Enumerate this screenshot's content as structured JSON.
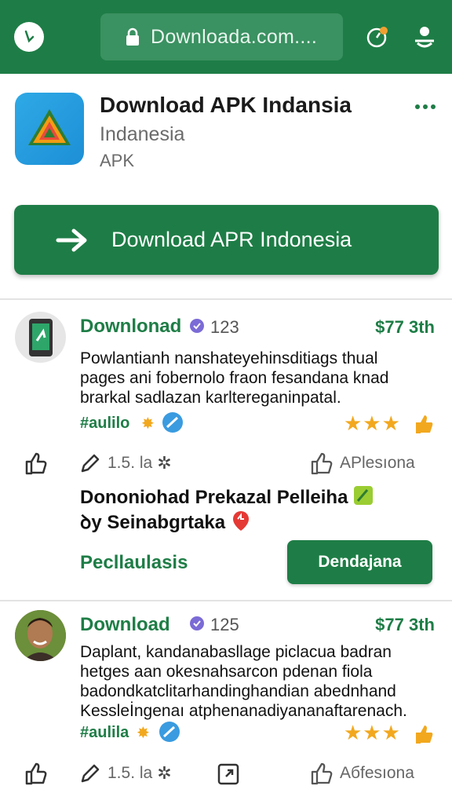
{
  "browser": {
    "url": "Downloada.com....",
    "icons": [
      "clock-icon",
      "lock-icon",
      "timer-badge-icon",
      "account-icon"
    ]
  },
  "app": {
    "title": "Download APK Indansia",
    "subtitle": "Indanesia",
    "category": "APK",
    "download_label": "Download APR Indonesia"
  },
  "cards": [
    {
      "name": "Downlonad",
      "count": "123",
      "price": "$77 3th",
      "description": "Powlantianh nanshateyehinsditiags thual pages ani fobernolo fraon fesandana knad brarkal sadlazan karlteregan­inpatal.",
      "tag": "#aulilo",
      "stars": "★★★",
      "version": "1.5. la",
      "right_action": "APlesıona",
      "promo_line1": "Dononiohad Prekazal Pelleiha",
      "promo_line2": "ꝺy Seinabgrtaka",
      "link": "Pecllaulasis",
      "button": "Dendajana"
    },
    {
      "name": "Download",
      "count": "125",
      "price": "$77 3th",
      "description": "Daplant, kandanabasllage piclacua badran hetges aan okesnahsarcon pdenan fiola badondkatclitarhandinghandian abednhand Kessleİngenaı atphenanadiyananaftarenach.",
      "tag": "#aulila",
      "stars": "★★★",
      "version": "1.5. la",
      "right_action": "Aбfesıona"
    }
  ],
  "colors": {
    "brand_green": "#1e7d46",
    "star": "#f2a81e"
  }
}
